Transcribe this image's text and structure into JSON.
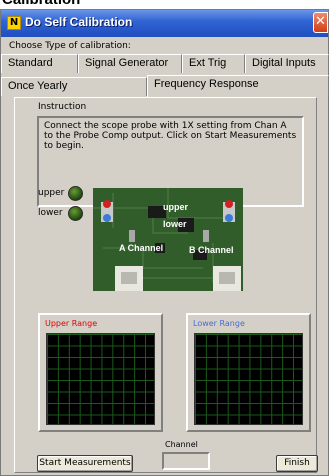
{
  "page_caption": "Calibration",
  "window": {
    "title": "Do Self Calibration",
    "icon": "app-icon",
    "close_glyph": "✕"
  },
  "calibration_type_label": "Choose Type of calibration:",
  "tabs": [
    {
      "label": "Standard"
    },
    {
      "label": "Signal Generator"
    },
    {
      "label": "Ext Trig"
    },
    {
      "label": "Digital Inputs"
    },
    {
      "label": "Once Yearly"
    },
    {
      "label": "Frequency Response",
      "active": true
    }
  ],
  "instruction": {
    "label": "Instruction",
    "text": "Connect the scope probe with 1X setting from Chan A to the Probe Comp output. Click on Start Measurements to begin."
  },
  "indicators": [
    {
      "label": "upper",
      "color": "#1f4a0a"
    },
    {
      "label": "lower",
      "color": "#1f4a0a"
    }
  ],
  "board": {
    "upper_label": "upper",
    "lower_label": "lower",
    "channel_a_label": "A Channel",
    "channel_b_label": "B Channel"
  },
  "graphs": {
    "upper": {
      "title": "Upper Range",
      "title_color": "#e00000"
    },
    "lower": {
      "title": "Lower Range",
      "title_color": "#4a6ad8"
    },
    "grid_color": "#1c5a1c"
  },
  "channel": {
    "label": "Channel",
    "value": ""
  },
  "buttons": {
    "start": "Start Measurements",
    "finish": "Finish"
  }
}
